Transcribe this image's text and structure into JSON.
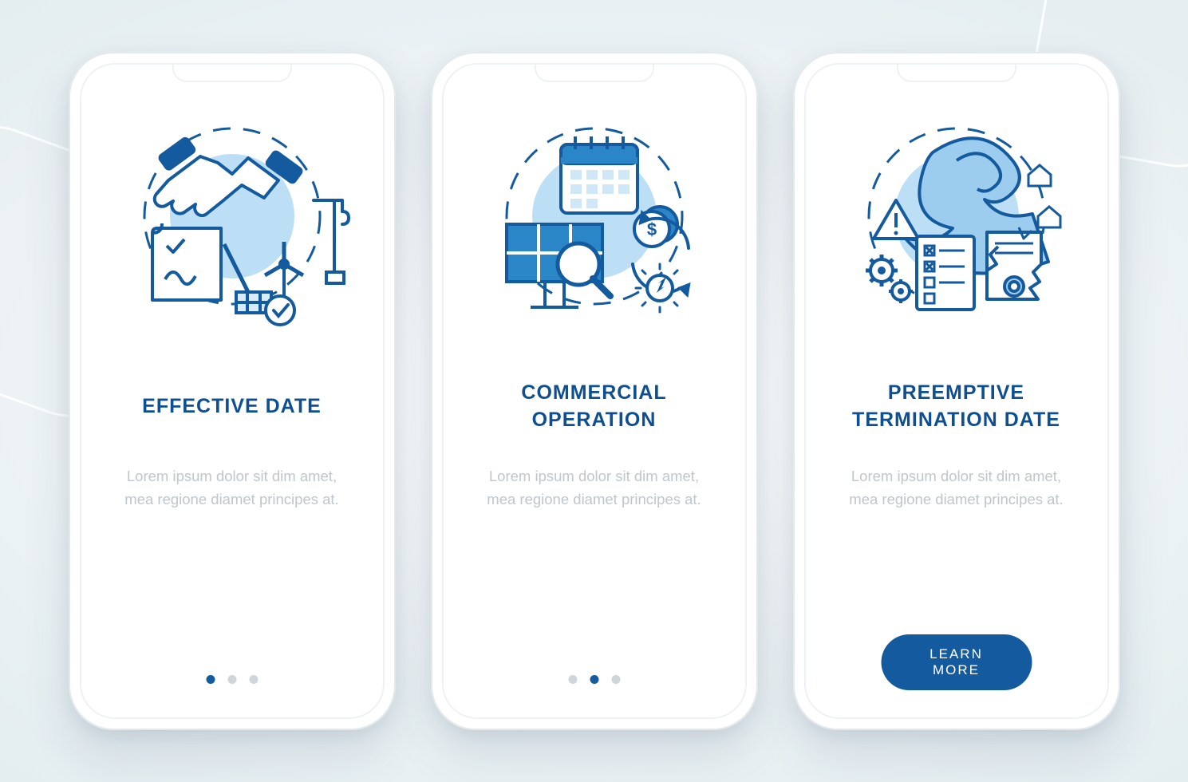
{
  "colors": {
    "brand": "#145a9e",
    "brand_light": "#a0d2ef",
    "text_muted": "#bfc6cc",
    "background_tint": "#e9f0f3"
  },
  "cta_label": "LEARN MORE",
  "body_text": "Lorem ipsum dolor sit dim amet, mea regione diamet principes at.",
  "screens": [
    {
      "title": "EFFECTIVE DATE",
      "icon_semantic": "handshake-contract-energy",
      "page_index": 0,
      "has_cta": false
    },
    {
      "title": "COMMERCIAL OPERATION",
      "icon_semantic": "calendar-solar-money-energy",
      "page_index": 1,
      "has_cta": false
    },
    {
      "title": "PREEMPTIVE TERMINATION DATE",
      "icon_semantic": "disaster-torn-contract-warning",
      "page_index": 2,
      "has_cta": true
    }
  ],
  "total_pages": 3
}
